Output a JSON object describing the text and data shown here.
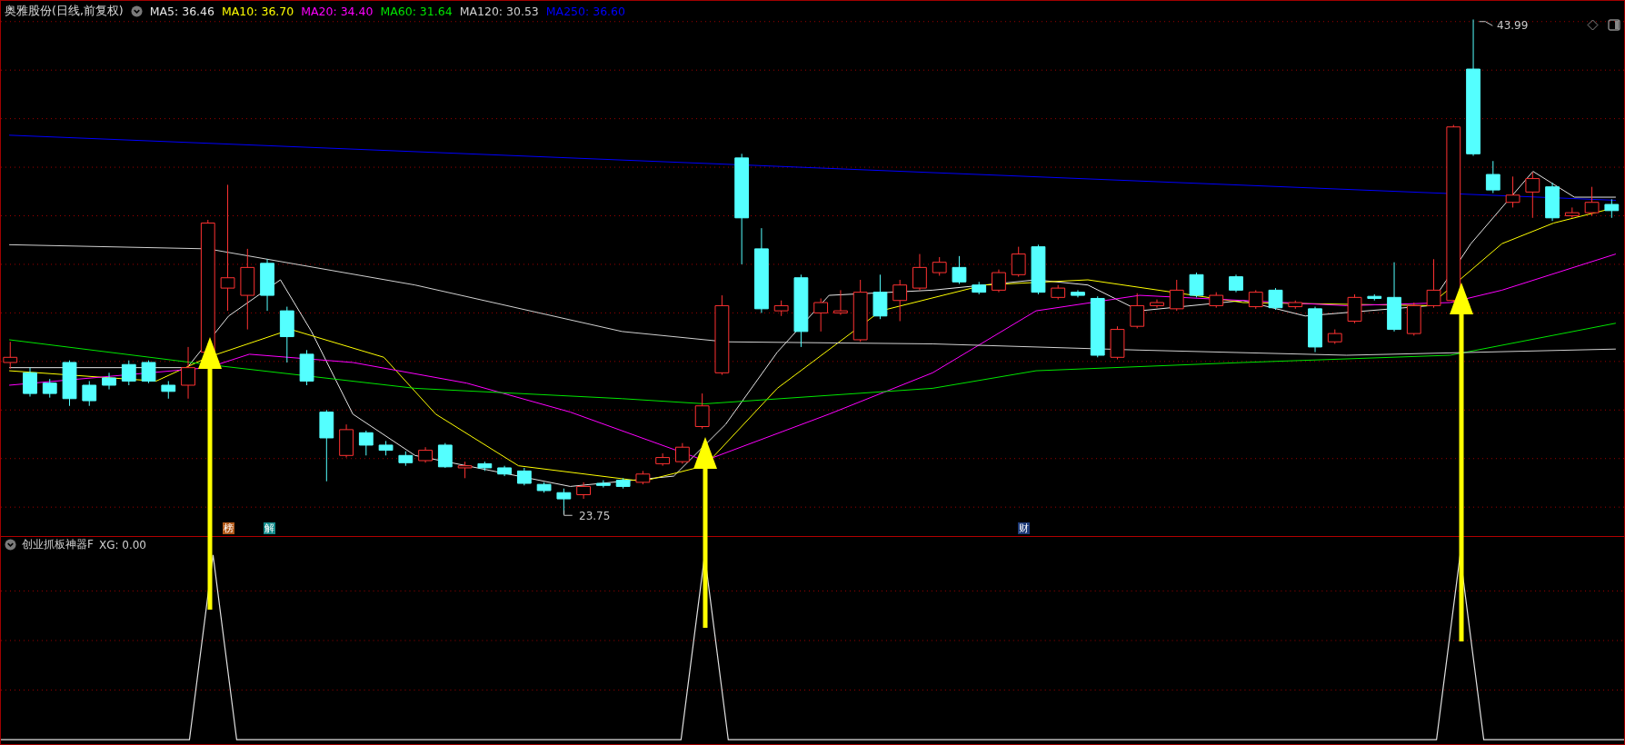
{
  "chart_header": {
    "title": "奥雅股份(日线,前复权)",
    "indicators": [
      {
        "label": "MA5: 36.46",
        "color": "#e6e6e6"
      },
      {
        "label": "MA10: 36.70",
        "color": "#ffff00"
      },
      {
        "label": "MA20: 34.40",
        "color": "#ff00ff"
      },
      {
        "label": "MA60: 31.64",
        "color": "#00e600"
      },
      {
        "label": "MA120: 30.53",
        "color": "#d0d0d0"
      },
      {
        "label": "MA250: 36.60",
        "color": "#0000ff"
      }
    ]
  },
  "price_labels": {
    "high": "43.99",
    "low": "23.75"
  },
  "event_markers": [
    {
      "label": "榜",
      "color": "#b35a1a"
    },
    {
      "label": "解",
      "color": "#138a8a"
    },
    {
      "label": "财",
      "color": "#1d3a78"
    }
  ],
  "indicator_panel": {
    "name": "创业抓板神器F",
    "value": "XG: 0.00"
  }
}
